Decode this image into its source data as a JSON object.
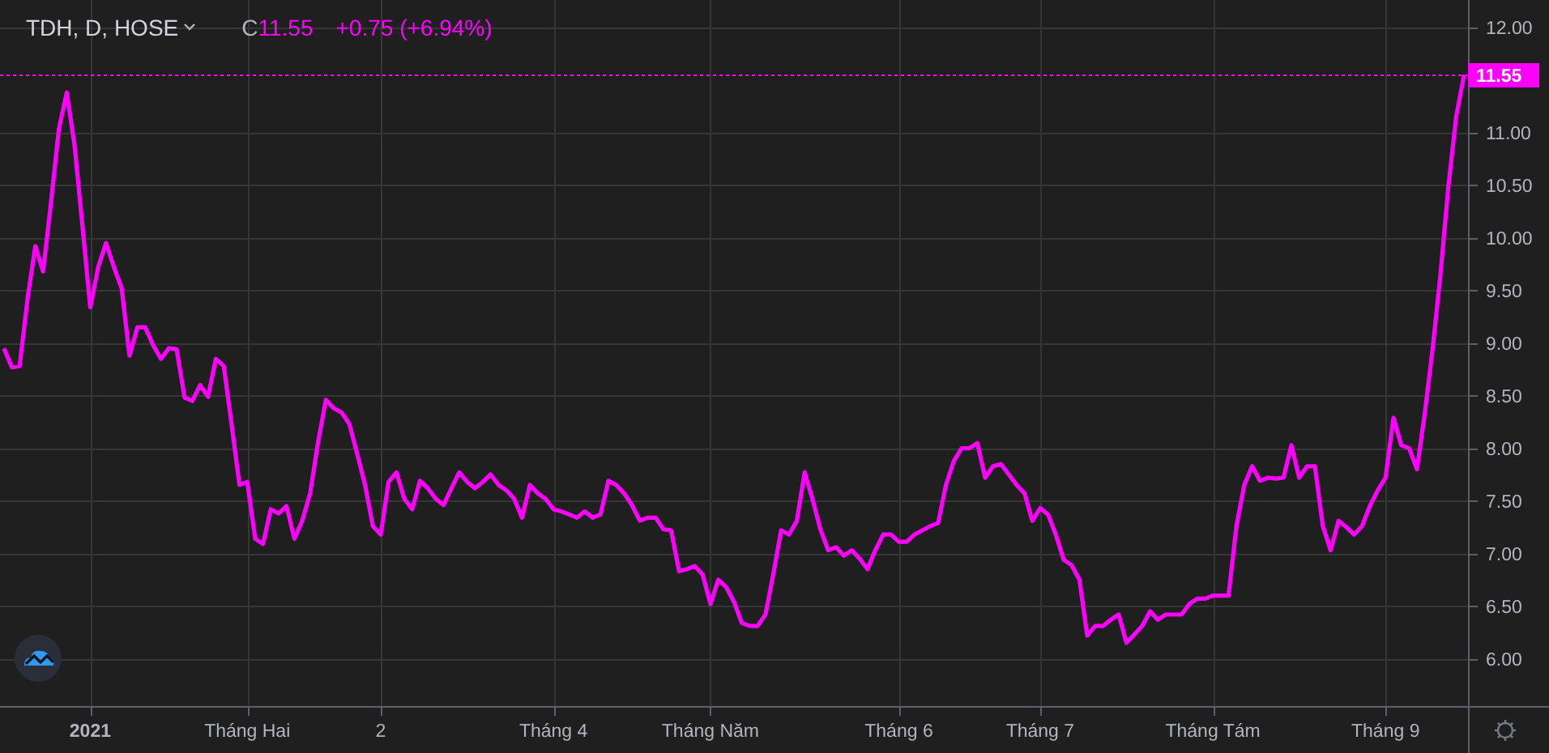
{
  "header": {
    "symbol": "TDH, D, HOSE",
    "close_label": "C",
    "close": "11.55",
    "change": "+0.75 (+6.94%)"
  },
  "chart": {
    "chart_data": {
      "type": "line",
      "grid": true,
      "ylim": [
        5.55,
        12.26
      ],
      "ref_lines": [
        {
          "axis": "y",
          "value": 11.55,
          "label": "11.55",
          "color": "#ff00ff"
        }
      ],
      "categories": [
        null,
        null,
        null,
        null,
        null,
        null,
        null,
        null,
        null,
        null,
        null,
        "2021",
        null,
        null,
        null,
        null,
        null,
        null,
        null,
        null,
        null,
        null,
        null,
        null,
        null,
        null,
        null,
        null,
        null,
        null,
        null,
        "Tháng Hai",
        null,
        null,
        null,
        null,
        null,
        null,
        null,
        null,
        null,
        null,
        null,
        null,
        null,
        null,
        null,
        null,
        "2",
        null,
        null,
        null,
        null,
        null,
        null,
        null,
        null,
        null,
        null,
        null,
        null,
        null,
        null,
        null,
        null,
        null,
        null,
        null,
        null,
        null,
        "Tháng 4",
        null,
        null,
        null,
        null,
        null,
        null,
        null,
        null,
        null,
        null,
        null,
        null,
        null,
        null,
        null,
        null,
        null,
        null,
        null,
        "Tháng Năm",
        null,
        null,
        null,
        null,
        null,
        null,
        null,
        null,
        null,
        null,
        null,
        null,
        null,
        null,
        null,
        null,
        null,
        null,
        null,
        null,
        null,
        null,
        null,
        "Tháng 6",
        null,
        null,
        null,
        null,
        null,
        null,
        null,
        null,
        null,
        null,
        null,
        null,
        null,
        null,
        null,
        null,
        null,
        "Tháng 7",
        null,
        null,
        null,
        null,
        null,
        null,
        null,
        null,
        null,
        null,
        null,
        null,
        null,
        null,
        null,
        null,
        null,
        null,
        null,
        null,
        null,
        "Tháng Tám",
        null,
        null,
        null,
        null,
        null,
        null,
        null,
        null,
        null,
        null,
        null,
        null,
        null,
        null,
        null,
        null,
        null,
        null,
        null,
        null,
        null,
        "Tháng 9",
        null,
        null,
        null,
        null,
        null,
        null,
        null,
        null,
        null,
        null
      ],
      "yticks": [
        {
          "value": 6,
          "label": "6.00"
        },
        {
          "value": 6.5,
          "label": "6.50"
        },
        {
          "value": 7,
          "label": "7.00"
        },
        {
          "value": 7.5,
          "label": "7.50"
        },
        {
          "value": 8,
          "label": "8.00"
        },
        {
          "value": 8.5,
          "label": "8.50"
        },
        {
          "value": 9,
          "label": "9.00"
        },
        {
          "value": 9.5,
          "label": "9.50"
        },
        {
          "value": 10,
          "label": "10.00"
        },
        {
          "value": 10.5,
          "label": "10.50"
        },
        {
          "value": 11,
          "label": "11.00"
        },
        {
          "value": 12,
          "label": "12.00"
        }
      ],
      "series": [
        {
          "color": "#ff00ff",
          "values": [
            8.95,
            8.77,
            8.78,
            9.42,
            9.92,
            9.68,
            10.34,
            11.03,
            11.38,
            10.88,
            10.11,
            9.34,
            9.72,
            9.95,
            9.72,
            9.52,
            8.88,
            9.15,
            9.15,
            8.98,
            8.85,
            8.95,
            8.94,
            8.48,
            8.45,
            8.6,
            8.49,
            8.85,
            8.78,
            8.23,
            7.65,
            7.68,
            7.14,
            7.09,
            7.42,
            7.38,
            7.45,
            7.14,
            7.31,
            7.57,
            8.05,
            8.46,
            8.38,
            8.34,
            8.23,
            7.95,
            7.65,
            7.26,
            7.18,
            7.68,
            7.77,
            7.52,
            7.42,
            7.69,
            7.62,
            7.52,
            7.46,
            7.62,
            7.77,
            7.68,
            7.62,
            7.68,
            7.75,
            7.65,
            7.6,
            7.52,
            7.34,
            7.65,
            7.57,
            7.52,
            7.42,
            7.4,
            7.37,
            7.34,
            7.4,
            7.34,
            7.37,
            7.69,
            7.65,
            7.57,
            7.46,
            7.31,
            7.34,
            7.34,
            7.23,
            7.22,
            6.83,
            6.85,
            6.88,
            6.8,
            6.52,
            6.75,
            6.68,
            6.54,
            6.34,
            6.31,
            6.31,
            6.42,
            6.8,
            7.22,
            7.18,
            7.31,
            7.77,
            7.52,
            7.23,
            7.03,
            7.06,
            6.98,
            7.03,
            6.95,
            6.85,
            7.03,
            7.18,
            7.18,
            7.11,
            7.11,
            7.18,
            7.22,
            7.26,
            7.29,
            7.65,
            7.88,
            8.0,
            8.0,
            8.05,
            7.72,
            7.83,
            7.85,
            7.75,
            7.65,
            7.57,
            7.31,
            7.43,
            7.37,
            7.18,
            6.94,
            6.89,
            6.75,
            6.22,
            6.31,
            6.31,
            6.37,
            6.42,
            6.15,
            6.23,
            6.31,
            6.45,
            6.37,
            6.42,
            6.42,
            6.42,
            6.52,
            6.57,
            6.57,
            6.6,
            6.6,
            6.6,
            7.26,
            7.65,
            7.83,
            7.69,
            7.72,
            7.71,
            7.72,
            8.03,
            7.72,
            7.83,
            7.83,
            7.26,
            7.03,
            7.31,
            7.25,
            7.18,
            7.26,
            7.45,
            7.6,
            7.72,
            8.29,
            8.03,
            8.0,
            7.8,
            8.34,
            8.95,
            9.65,
            10.49,
            11.15,
            11.55
          ]
        }
      ]
    }
  }
}
